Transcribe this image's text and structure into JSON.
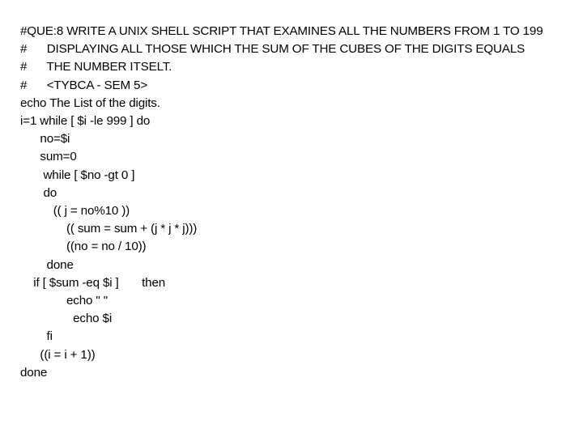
{
  "slide": {
    "title": "#QUE:8 WRITE A UNIX SHELL SCRIPT THAT EXAMINES ALL THE NUMBERS FROM 1 TO 199",
    "background_color": "#ffffff",
    "text_color": "#000000"
  },
  "code": {
    "language": "unix-shell-script",
    "lines": [
      "#QUE:8 WRITE A UNIX SHELL SCRIPT THAT EXAMINES ALL THE NUMBERS FROM 1 TO 199",
      "#      DISPLAYING ALL THOSE WHICH THE SUM OF THE CUBES OF THE DIGITS EQUALS",
      "#      THE NUMBER ITSELT.",
      "#      <TYBCA - SEM 5>",
      "echo The List of the digits.",
      "i=1 while [ $i -le 999 ] do",
      "      no=$i",
      "      sum=0",
      "       while [ $no -gt 0 ]",
      "       do",
      "          (( j = no%10 ))",
      "              (( sum = sum + (j * j * j)))",
      "              ((no = no / 10))",
      "        done",
      "    if [ $sum -eq $i ]       then",
      "              echo \" \"",
      "                echo $i",
      "        fi",
      "      ((i = i + 1))",
      "done"
    ]
  }
}
